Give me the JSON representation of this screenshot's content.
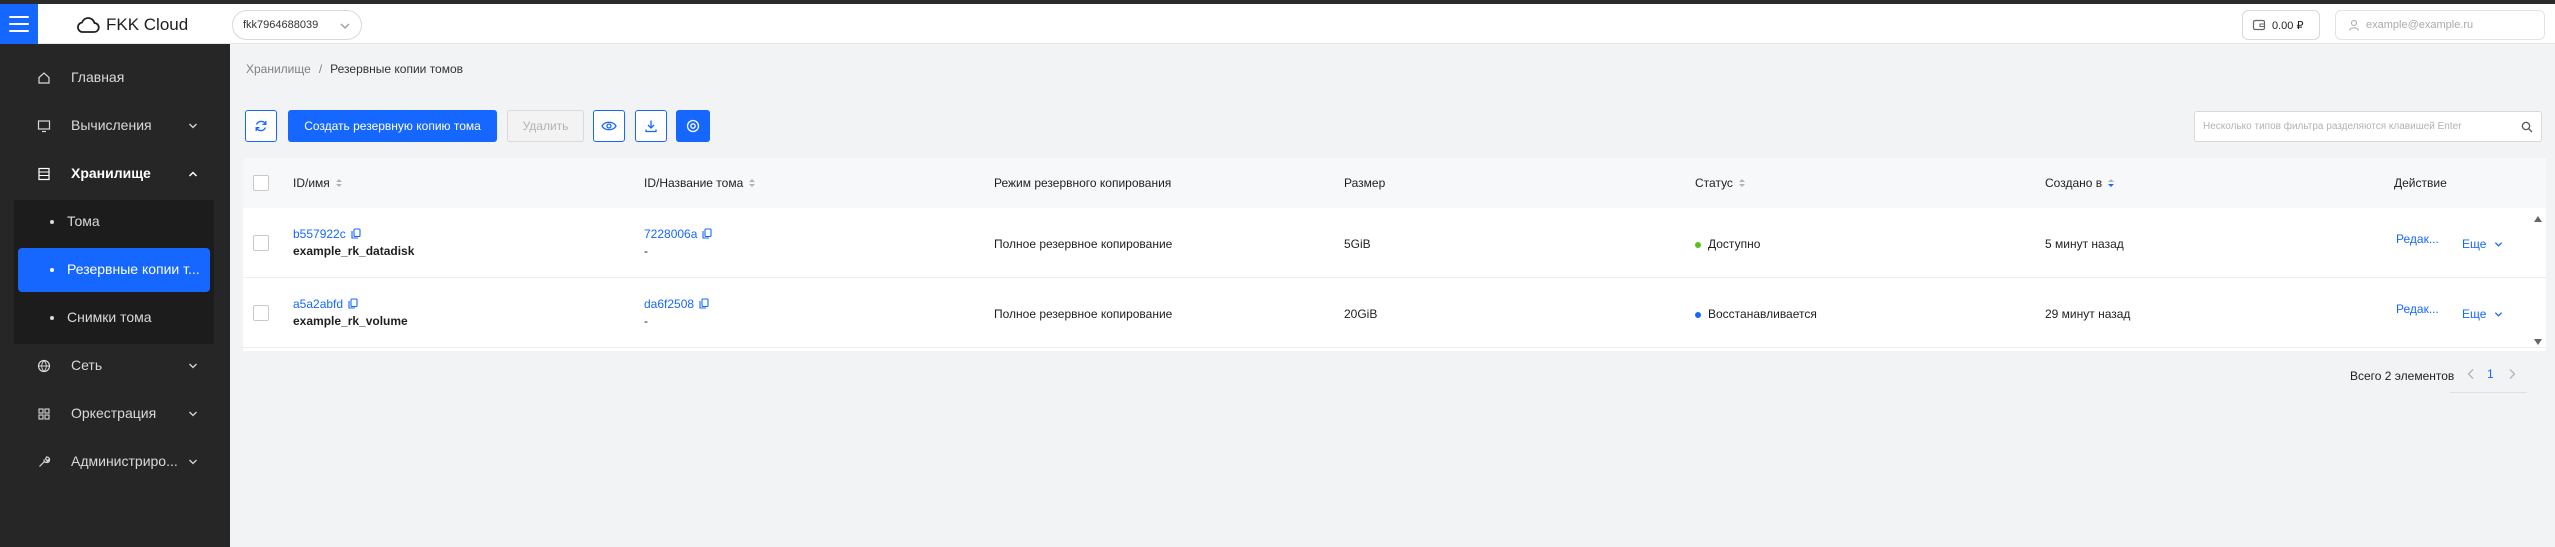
{
  "header": {
    "brand": "FKK Cloud",
    "project": "fkk7964688039",
    "balance": "0.00 ₽",
    "user_email": "example@example.ru"
  },
  "sidebar": {
    "items": [
      {
        "label": "Главная",
        "icon": "home-icon"
      },
      {
        "label": "Вычисления",
        "icon": "monitor-icon"
      },
      {
        "label": "Хранилище",
        "icon": "storage-icon"
      },
      {
        "label": "Сеть",
        "icon": "globe-icon"
      },
      {
        "label": "Оркестрация",
        "icon": "grid-icon"
      },
      {
        "label": "Администриро...",
        "icon": "wrench-icon"
      }
    ],
    "storage_sub": [
      {
        "label": "Тома"
      },
      {
        "label": "Резервные копии т..."
      },
      {
        "label": "Снимки тома"
      }
    ]
  },
  "breadcrumb": {
    "parent": "Хранилище",
    "separator": "/",
    "current": "Резервные копии томов"
  },
  "toolbar": {
    "create_label": "Создать резервную копию тома",
    "delete_label": "Удалить",
    "search_placeholder": "Несколько типов фильтра разделяются клавишей Enter"
  },
  "table": {
    "columns": [
      "ID/имя",
      "ID/Название тома",
      "Режим резервного копирования",
      "Размер",
      "Статус",
      "Создано в",
      "Действие"
    ],
    "rows": [
      {
        "id": "b557922c",
        "name": "example_rk_datadisk",
        "volume_id": "7228006a",
        "volume_name": "-",
        "mode": "Полное резервное копирование",
        "size": "5GiB",
        "status": "Доступно",
        "status_color": "#52c41a",
        "created": "5 минут назад",
        "edit": "Редак...",
        "more": "Еще"
      },
      {
        "id": "a5a2abfd",
        "name": "example_rk_volume",
        "volume_id": "da6f2508",
        "volume_name": "-",
        "mode": "Полное резервное копирование",
        "size": "20GiB",
        "status": "Восстанавливается",
        "status_color": "#1667ff",
        "created": "29 минут назад",
        "edit": "Редак...",
        "more": "Еще"
      }
    ]
  },
  "pagination": {
    "total_label": "Всего 2 элементов",
    "current_page": "1"
  },
  "colors": {
    "accent": "#1667ff",
    "sidebar_bg": "#262626"
  }
}
